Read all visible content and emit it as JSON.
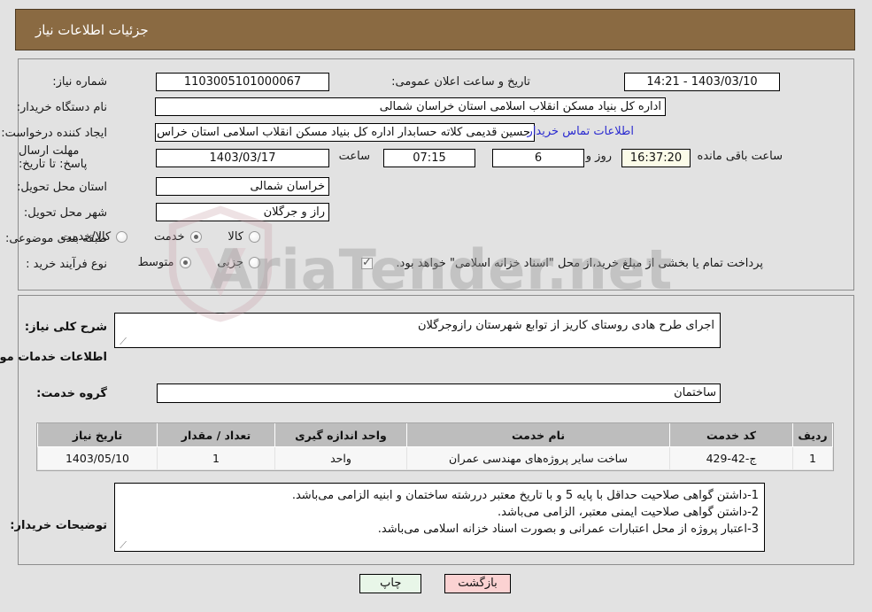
{
  "header": {
    "title": "جزئیات اطلاعات نیاز"
  },
  "watermark": {
    "text": "AriaTender.net"
  },
  "form": {
    "need_number": {
      "label": "شماره نیاز:",
      "value": "1103005101000067"
    },
    "public_announce": {
      "label": "تاریخ و ساعت اعلان عمومی:",
      "value": "1403/03/10 - 14:21"
    },
    "buyer_org": {
      "label": "نام دستگاه خریدار:",
      "value": "اداره کل بنیاد مسکن انقلاب اسلامی استان خراسان شمالی"
    },
    "requester": {
      "label": "ایجاد کننده درخواست:",
      "value": "حسین قدیمی کلاته حسابدار اداره کل بنیاد مسکن انقلاب اسلامی استان خراس",
      "contact_link": "اطلاعات تماس خریدار"
    },
    "deadline": {
      "label": "مهلت ارسال پاسخ: تا تاریخ:",
      "date": "1403/03/17",
      "time_label": "ساعت",
      "time": "07:15",
      "days": "6",
      "days_suffix": "روز و",
      "remaining": "16:37:20",
      "remaining_suffix": "ساعت باقی مانده"
    },
    "province": {
      "label": "استان محل تحویل:",
      "value": "خراسان شمالی"
    },
    "city": {
      "label": "شهر محل تحویل:",
      "value": "راز و جرگلان"
    },
    "category": {
      "label": "طبقه بندی موضوعی:",
      "options": [
        {
          "label": "کالا",
          "checked": false
        },
        {
          "label": "خدمت",
          "checked": true
        },
        {
          "label": "کالا/خدمت",
          "checked": false
        }
      ]
    },
    "purchase_type": {
      "label": "نوع فرآیند خرید :",
      "options": [
        {
          "label": "جزیی",
          "checked": false
        },
        {
          "label": "متوسط",
          "checked": true
        }
      ],
      "treasury_checkbox": {
        "checked": true
      },
      "treasury_note": "پرداخت تمام یا بخشی از مبلغ خرید،از محل \"اسناد خزانه اسلامی\" خواهد بود."
    }
  },
  "body": {
    "need_desc": {
      "label": "شرح کلی نیاز:",
      "value": "اجرای طرح هادی روستای کاریز از توابع شهرستان رازوجرگلان"
    },
    "services_heading": "اطلاعات خدمات مورد نیاز",
    "service_group": {
      "label": "گروه خدمت:",
      "value": "ساختمان"
    },
    "buyer_notes": {
      "label": "توضیحات خریدار:",
      "lines": [
        "1-داشتن گواهی صلاحیت حداقل با پایه 5 و با تاریخ معتبر دررشته ساختمان و ابنیه  الزامی می‌باشد.",
        "2-داشتن گواهی صلاحیت ایمنی معتبر، الزامی می‌باشد.",
        "3-اعتبار پروژه از محل اعتبارات عمرانی و بصورت اسناد خزانه اسلامی می‌باشد."
      ]
    }
  },
  "table": {
    "columns": [
      "ردیف",
      "کد خدمت",
      "نام خدمت",
      "واحد اندازه گیری",
      "تعداد / مقدار",
      "تاریخ نیاز"
    ],
    "rows": [
      {
        "row_no": "1",
        "service_code": "ج-42-429",
        "service_name": "ساخت سایر پروژه‌های مهندسی عمران",
        "unit": "واحد",
        "quantity": "1",
        "need_date": "1403/05/10"
      }
    ]
  },
  "footer": {
    "print_label": "چاپ",
    "back_label": "بازگشت"
  },
  "colors": {
    "header_bg": "#8a6a42",
    "page_bg": "#e2e2e2",
    "link": "#2b2bd0",
    "table_header": "#bdbdbd",
    "print_btn": "#e8f6e8",
    "back_btn": "#fbd2d2",
    "cream_field": "#fbfbe8"
  }
}
